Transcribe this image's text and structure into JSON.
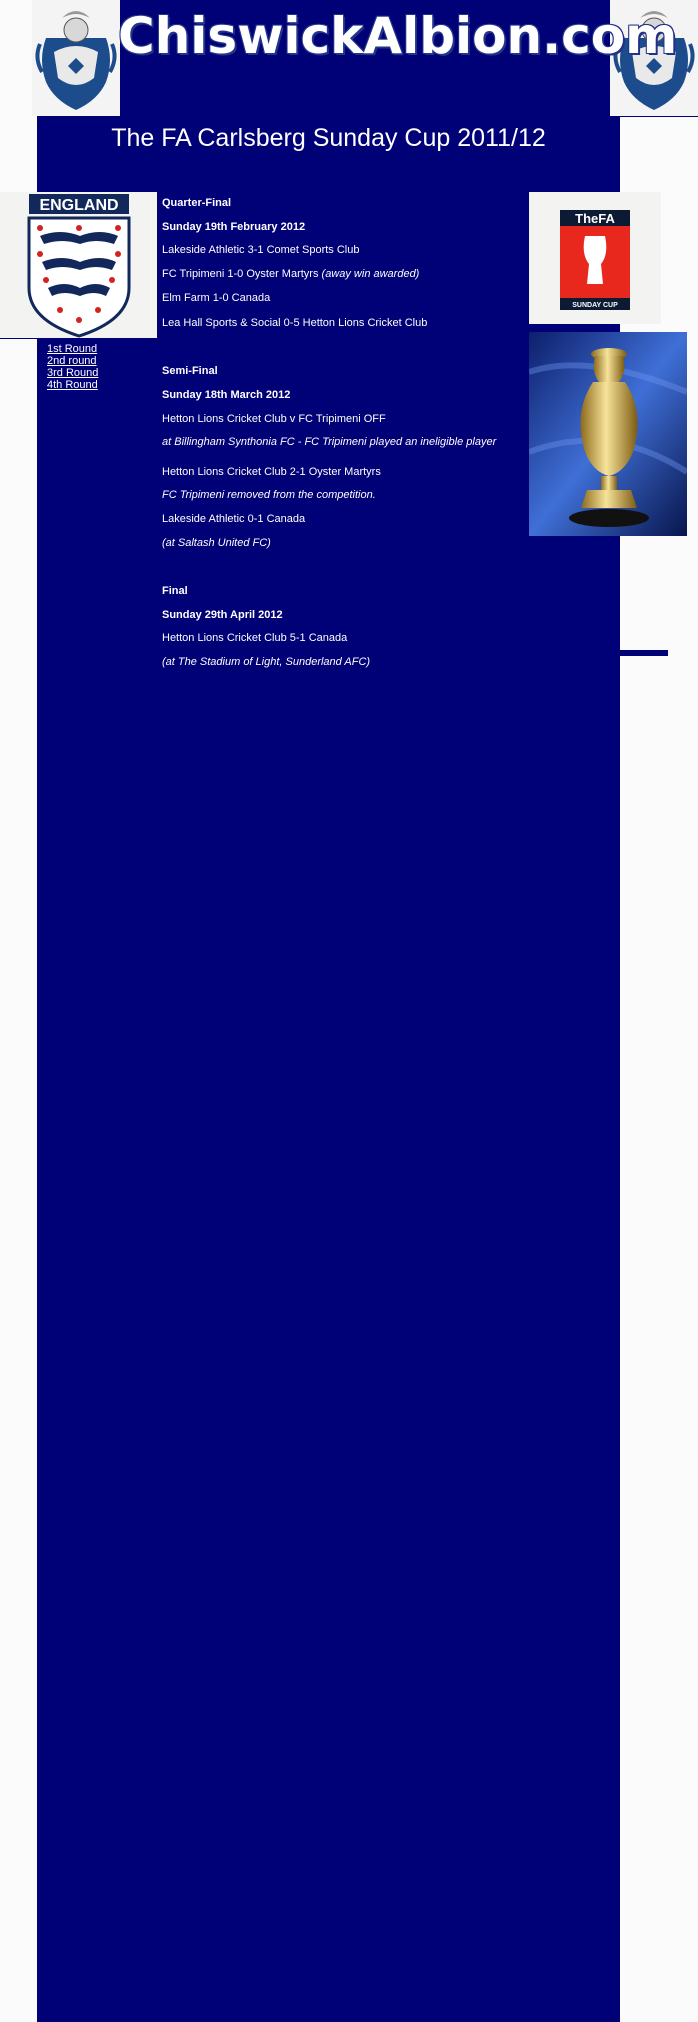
{
  "site": {
    "title": "ChiswickAlbion.com"
  },
  "page": {
    "heading": "The FA Carlsberg Sunday Cup 2011/12"
  },
  "nav": {
    "items": [
      "1st Round",
      "2nd round",
      "3rd Round",
      "4th Round"
    ]
  },
  "badges": {
    "england_label": "ENGLAND",
    "fa_top": "TheFA",
    "fa_bottom": "SUNDAY CUP"
  },
  "quarter": {
    "title": "Quarter-Final",
    "date": "Sunday 19th February 2012",
    "m1": "Lakeside Athletic 3-1 Comet Sports Club",
    "m2": "FC Tripimeni 1-0 Oyster Martyrs",
    "m2_note": "(away win awarded)",
    "m3": "Elm Farm 1-0 Canada",
    "m4": "Lea Hall Sports & Social 0-5 Hetton Lions Cricket Club"
  },
  "semi": {
    "title": "Semi-Final",
    "date": "Sunday 18th March 2012",
    "m1": "Hetton Lions Cricket Club v FC Tripimeni OFF",
    "m1_note": "at Billingham Synthonia FC - FC Tripimeni played an ineligible player",
    "m2": "Hetton Lions Cricket Club 2-1 Oyster Martyrs",
    "m2_note": "FC Tripimeni removed from the competition.",
    "m3": "Lakeside Athletic 0-1 Canada",
    "m3_note": "(at Saltash United FC)"
  },
  "final": {
    "title": "Final",
    "date": "Sunday 29th April 2012",
    "m1": "Hetton Lions Cricket Club 5-1 Canada",
    "m1_note": "(at The Stadium of Light, Sunderland AFC)"
  },
  "colors": {
    "panel": "#000077",
    "background": "#fbfbfb",
    "fa_red": "#e8281c"
  }
}
